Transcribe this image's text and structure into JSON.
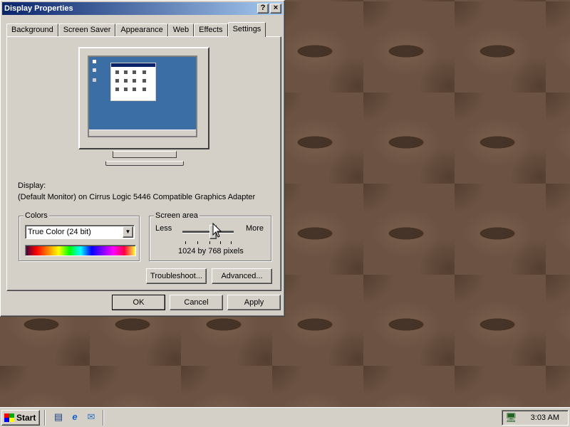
{
  "window": {
    "title": "Display Properties",
    "help_label": "?",
    "close_label": "×"
  },
  "tabs": [
    {
      "label": "Background"
    },
    {
      "label": "Screen Saver"
    },
    {
      "label": "Appearance"
    },
    {
      "label": "Web"
    },
    {
      "label": "Effects"
    },
    {
      "label": "Settings",
      "active": true
    }
  ],
  "settings": {
    "display_label": "Display:",
    "display_value": "(Default Monitor) on Cirrus Logic 5446 Compatible Graphics Adapter",
    "colors": {
      "legend": "Colors",
      "selected": "True Color (24 bit)"
    },
    "screen_area": {
      "legend": "Screen area",
      "less_label": "Less",
      "more_label": "More",
      "value_text": "1024 by 768 pixels",
      "slider_position_fraction": 0.6
    },
    "troubleshoot_label": "Troubleshoot...",
    "advanced_label": "Advanced..."
  },
  "dialog_buttons": {
    "ok": "OK",
    "cancel": "Cancel",
    "apply": "Apply"
  },
  "taskbar": {
    "start_label": "Start",
    "clock": "3:03 AM"
  },
  "colors": {
    "title_bar": "#0a246a",
    "face": "#d4d0c8",
    "desktop_preview": "#3a6ea5"
  }
}
